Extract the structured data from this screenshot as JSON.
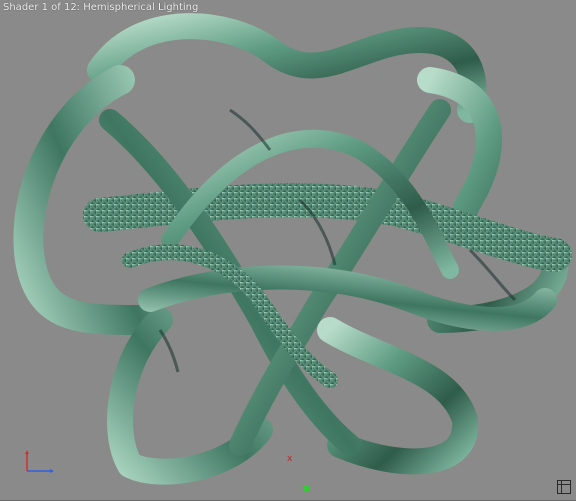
{
  "viewport": {
    "label": "Shader 1 of 12: Hemispherical Lighting",
    "background_color": "#8a8a8a"
  },
  "model": {
    "name": "twisted ribbon knot",
    "base_color": "#4f8a73",
    "highlight_color": "#a8d4bf",
    "shadow_color": "#1f3a30"
  },
  "gizmo": {
    "x_axis_color": "#d03030",
    "y_axis_color": "#3060e0",
    "origin_marker": "x"
  },
  "icons": {
    "axis": "axis-gizmo-icon",
    "corner": "viewport-corner-icon"
  }
}
